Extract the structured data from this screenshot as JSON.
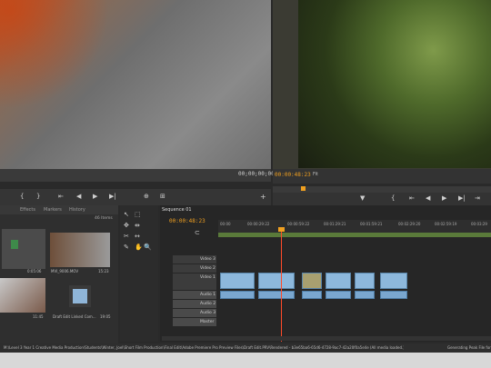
{
  "source": {
    "timecode_left": "",
    "timecode_right": "00;00;00;00"
  },
  "program": {
    "timecode": "00:00:48:23",
    "fit": "Fit"
  },
  "project": {
    "tabs": [
      "Effects",
      "Markers",
      "History"
    ],
    "count": "46 Items",
    "items": [
      {
        "name": "",
        "duration": "0:05:06"
      },
      {
        "name": "MVI_9006.MOV",
        "duration": "15:23"
      },
      {
        "name": "",
        "duration": "11:45"
      },
      {
        "name": "Draft Edit Linked Com...",
        "duration": "19:05"
      }
    ]
  },
  "timeline": {
    "sequence_tab": "Sequence 01",
    "timecode": "00:00:48:23",
    "ruler": [
      "00:00",
      "00:00:29:22",
      "00:00:59:22",
      "00:01:29:21",
      "00:01:59:21",
      "00:02:29:20",
      "00:02:59:19",
      "00:03:29"
    ],
    "tracks": [
      "Video 3",
      "Video 2",
      "Video 1",
      "Audio 1",
      "Audio 2",
      "Audio 3",
      "Master"
    ]
  },
  "status": {
    "path": "M:\\Level 3 Year 1 Creative Media Production\\Students\\Winter, Joel\\Short Film Production\\Final Edit\\Adobe Premiere Pro Preview Files\\Draft Edit.PRV\\Rendered - b3e65ba6-65d6-4728-9ac7-42a20f0a5e4e (All media loaded.)",
    "right": "Generating Peak File for"
  },
  "colors": {
    "accent_timecode": "#f0a020",
    "playhead": "#ff4a2a",
    "clip_video": "#8db8dc",
    "clip_audio": "#7aa7cf"
  }
}
